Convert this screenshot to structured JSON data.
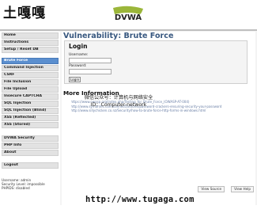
{
  "watermark_top": "土嘎嘎",
  "logo_text": "DVWA",
  "sidebar": {
    "group1": [
      "Home",
      "Instructions",
      "Setup / Reset DB"
    ],
    "group2": [
      "Brute Force",
      "Command Injection",
      "CSRF",
      "File Inclusion",
      "File Upload",
      "Insecure CAPTCHA",
      "SQL Injection",
      "SQL Injection (Blind)",
      "XSS (Reflected)",
      "XSS (Stored)"
    ],
    "group3": [
      "DVWA Security",
      "PHP Info",
      "About"
    ],
    "group4": [
      "Logout"
    ],
    "active": "Brute Force"
  },
  "user_info": [
    "Username: admin",
    "Security Level: impossible",
    "PHPIDS: disabled"
  ],
  "main": {
    "title": "Vulnerability: Brute Force",
    "login_title": "Login",
    "username_label": "Username:",
    "password_label": "Password:",
    "login_button": "Login",
    "more_title": "More Information",
    "links": [
      "https://www.owasp.org/index.php/Testing_for_Brute_Force_(OWASP-AT-004)",
      "http://www.symantec.com/connect/articles/password-crackers-ensuring-security-your-password",
      "http://www.sillychicken.co.nz/Security/how-to-brute-force-http-forms-in-windows.html"
    ],
    "overlay_line1": "微信公众号：计算机与网络安全",
    "overlay_line2": "ID：Computer-network",
    "footer_buttons": [
      "View Source",
      "View Help"
    ]
  },
  "bottom_watermark": "http://www.tugaga.com"
}
